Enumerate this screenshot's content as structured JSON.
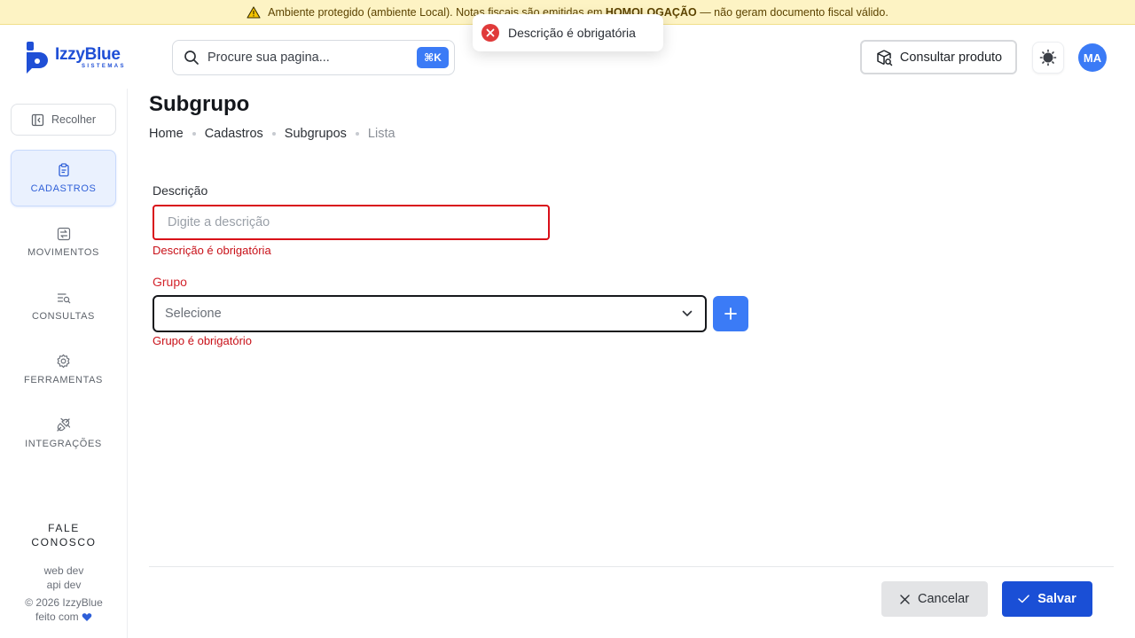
{
  "banner": {
    "text_before": "Ambiente protegido (ambiente Local). Notas fiscais são emitidas em",
    "text_bold": "HOMOLOGAÇÃO",
    "text_after": "— não geram documento fiscal válido.",
    "icon": "warning-icon"
  },
  "toast": {
    "message": "Descrição é obrigatória",
    "icon": "error-circle-icon",
    "color": "#e03a3a"
  },
  "header": {
    "logo_text": "IzzyBlue",
    "logo_subtext": "SISTEMAS",
    "search_placeholder": "Procure sua pagina...",
    "search_shortcut": "⌘K",
    "consult_label": "Consultar produto",
    "avatar_initials": "MA"
  },
  "sidebar": {
    "collapse_label": "Recolher",
    "items": [
      {
        "label": "CADASTROS",
        "icon": "clipboard-icon",
        "active": true
      },
      {
        "label": "MOVIMENTOS",
        "icon": "transfer-icon",
        "active": false
      },
      {
        "label": "CONSULTAS",
        "icon": "list-search-icon",
        "active": false
      },
      {
        "label": "FERRAMENTAS",
        "icon": "gear-icon",
        "active": false
      },
      {
        "label": "INTEGRAÇÕES",
        "icon": "plug-icon",
        "active": false
      }
    ],
    "contact_line1": "FALE",
    "contact_line2": "CONOSCO",
    "meta_web": "web dev",
    "meta_api": "api dev",
    "meta_copyright": "© 2026 IzzyBlue",
    "meta_made": "feito com"
  },
  "page": {
    "title": "Subgrupo",
    "breadcrumb": [
      "Home",
      "Cadastros",
      "Subgrupos",
      "Lista"
    ]
  },
  "form": {
    "descricao_label": "Descrição",
    "descricao_placeholder": "Digite a descrição",
    "descricao_value": "",
    "descricao_error": "Descrição é obrigatória",
    "grupo_label": "Grupo",
    "grupo_selected": "Selecione",
    "grupo_error": "Grupo é obrigatório"
  },
  "actions": {
    "cancel_label": "Cancelar",
    "save_label": "Salvar"
  },
  "colors": {
    "accent": "#3b7bf6",
    "primary": "#1a4fd6",
    "error": "#d90f18",
    "banner_bg": "#fdf3c4"
  }
}
